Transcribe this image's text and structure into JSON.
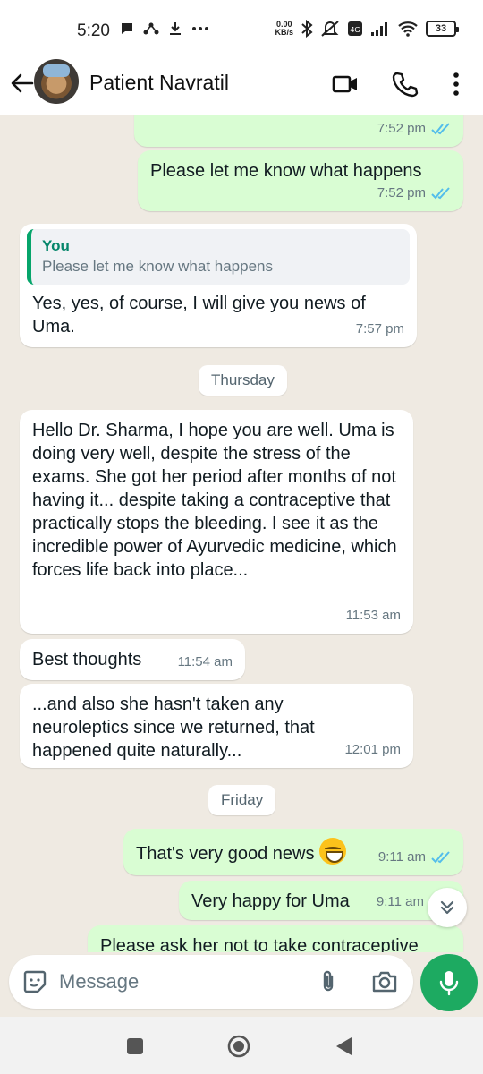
{
  "status_bar": {
    "time": "5:20",
    "network_speed_value": "0.00",
    "network_speed_unit": "KB/s",
    "battery": "33",
    "icons": [
      "chat-bubble-icon",
      "share-icon",
      "download-icon",
      "more-dots-icon",
      "bluetooth-icon",
      "mute-icon",
      "volte-icon",
      "signal-icon",
      "wifi-icon",
      "battery-icon"
    ]
  },
  "header": {
    "contact_name": "Patient Navratil",
    "icons": [
      "back-arrow-icon",
      "video-call-icon",
      "phone-icon",
      "menu-dots-icon"
    ]
  },
  "colors": {
    "outgoing_bubble": "#d9fdd3",
    "incoming_bubble": "#ffffff",
    "chat_background": "#efeae2",
    "accent_green": "#1daa61",
    "read_tick": "#53bdeb"
  },
  "messages": [
    {
      "id": "m0",
      "direction": "out",
      "text": "",
      "time": "7:52 pm",
      "read": true
    },
    {
      "id": "m1",
      "direction": "out",
      "text": "Please let me know what happens",
      "time": "7:52 pm",
      "read": true
    },
    {
      "id": "m2",
      "direction": "in",
      "quote_author": "You",
      "quote_text": "Please let me know what happens",
      "text": "Yes, yes, of course, I will give you news of Uma.",
      "time": "7:57 pm"
    },
    {
      "id": "d1",
      "type": "day",
      "text": "Thursday"
    },
    {
      "id": "m3",
      "direction": "in",
      "text": "Hello Dr. Sharma, I hope you are well. Uma is doing very well, despite the stress of the exams. She got her period after months of not having it... despite taking a contraceptive that practically stops the bleeding. I see it as the incredible power of Ayurvedic medicine, which forces life back into place...",
      "time": "11:53 am"
    },
    {
      "id": "m4",
      "direction": "in",
      "text": "Best thoughts",
      "time": "11:54 am"
    },
    {
      "id": "m5",
      "direction": "in",
      "text": "...and also she hasn't taken any neuroleptics since we returned, that happened quite naturally...",
      "time": "12:01 pm"
    },
    {
      "id": "d2",
      "type": "day",
      "text": "Friday"
    },
    {
      "id": "m6",
      "direction": "out",
      "text": "That's very good news",
      "emoji": "grinning-face",
      "time": "9:11 am",
      "read": true
    },
    {
      "id": "m7",
      "direction": "out",
      "text": "Very happy for Uma",
      "time": "9:11 am",
      "read": true
    },
    {
      "id": "m8",
      "direction": "out",
      "text": "Please ask her not to take contraceptive",
      "time": "",
      "read": false
    }
  ],
  "composer": {
    "placeholder": "Message",
    "icons": [
      "emoji-sticker-icon",
      "attach-icon",
      "camera-icon",
      "mic-icon"
    ]
  },
  "nav_bar": {
    "icons": [
      "recents-square-icon",
      "home-circle-icon",
      "back-triangle-icon"
    ]
  }
}
